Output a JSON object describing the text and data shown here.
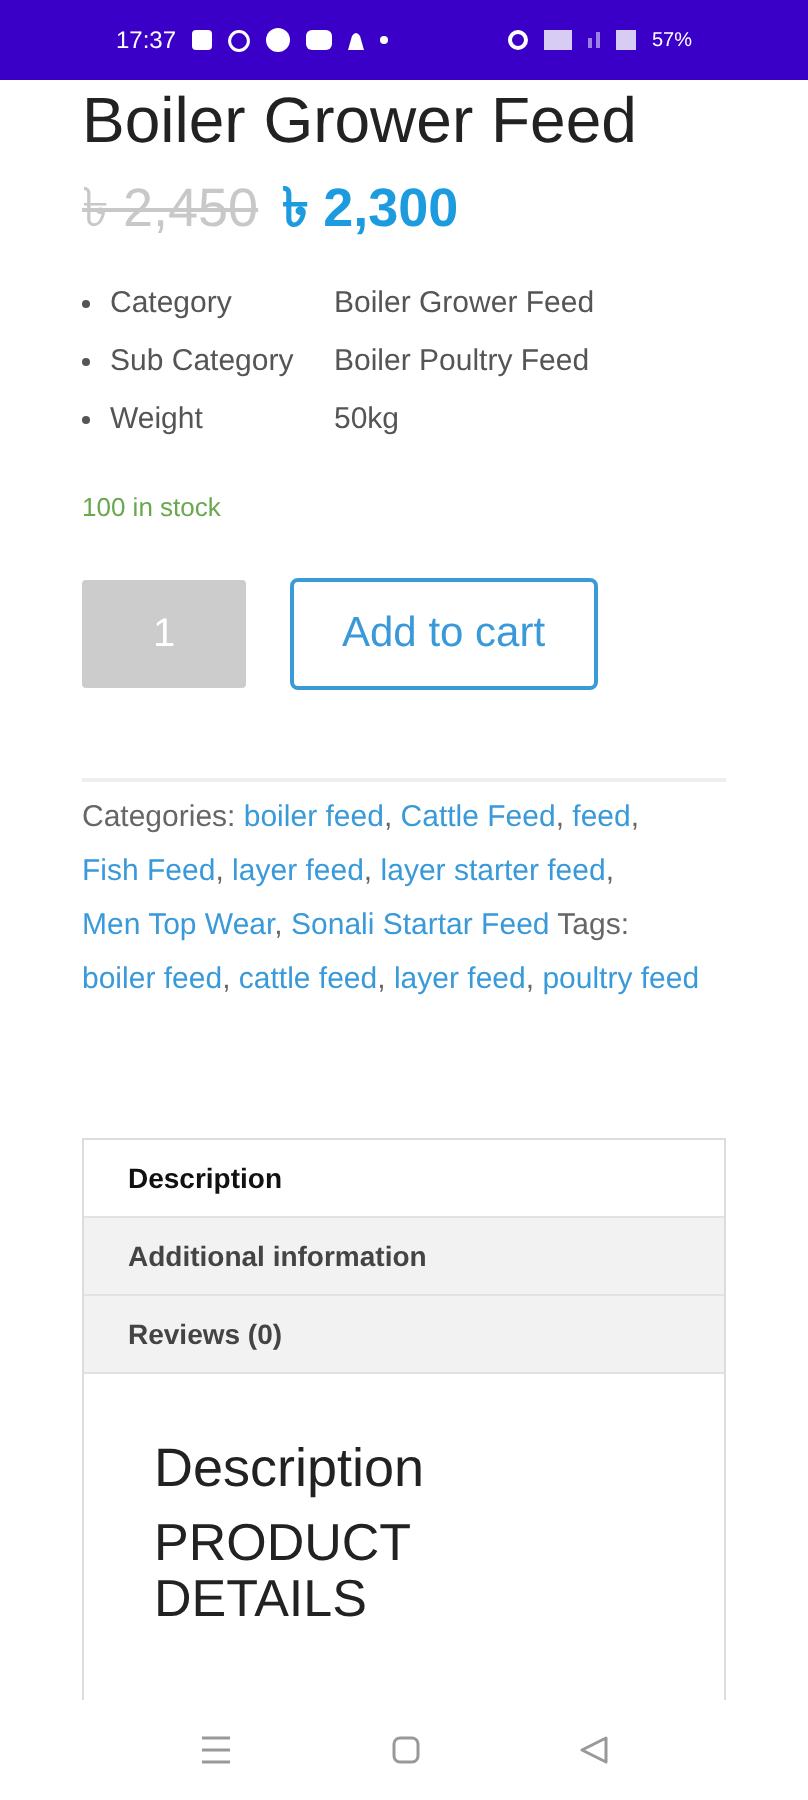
{
  "status_bar": {
    "time": "17:37",
    "battery": "57%"
  },
  "product": {
    "title": "Boiler Grower Feed",
    "old_price": "৳ 2,450",
    "price": "৳ 2,300"
  },
  "attributes": [
    {
      "name": "Category",
      "value": "Boiler Grower Feed"
    },
    {
      "name": "Sub Category",
      "value": "Boiler Poultry Feed"
    },
    {
      "name": "Weight",
      "value": "50kg"
    }
  ],
  "stock": "100 in stock",
  "quantity": "1",
  "add_to_cart": "Add to cart",
  "meta": {
    "separator": ",",
    "categories": {
      "label": "Categories:",
      "links": [
        "boiler feed",
        "Cattle Feed",
        "feed",
        "Fish Feed",
        "layer feed",
        "layer starter feed",
        "Men Top Wear",
        "Sonali Startar Feed"
      ]
    },
    "tags": {
      "label": "Tags:",
      "links": [
        "boiler feed",
        "cattle feed",
        "layer feed",
        "poultry feed"
      ]
    }
  },
  "tabs": [
    {
      "label": "Description",
      "selected": true
    },
    {
      "label": "Additional information",
      "selected": false
    },
    {
      "label": "Reviews (0)",
      "selected": false
    }
  ],
  "panel": {
    "heading": "Description",
    "subheading": "PRODUCT DETAILS"
  }
}
